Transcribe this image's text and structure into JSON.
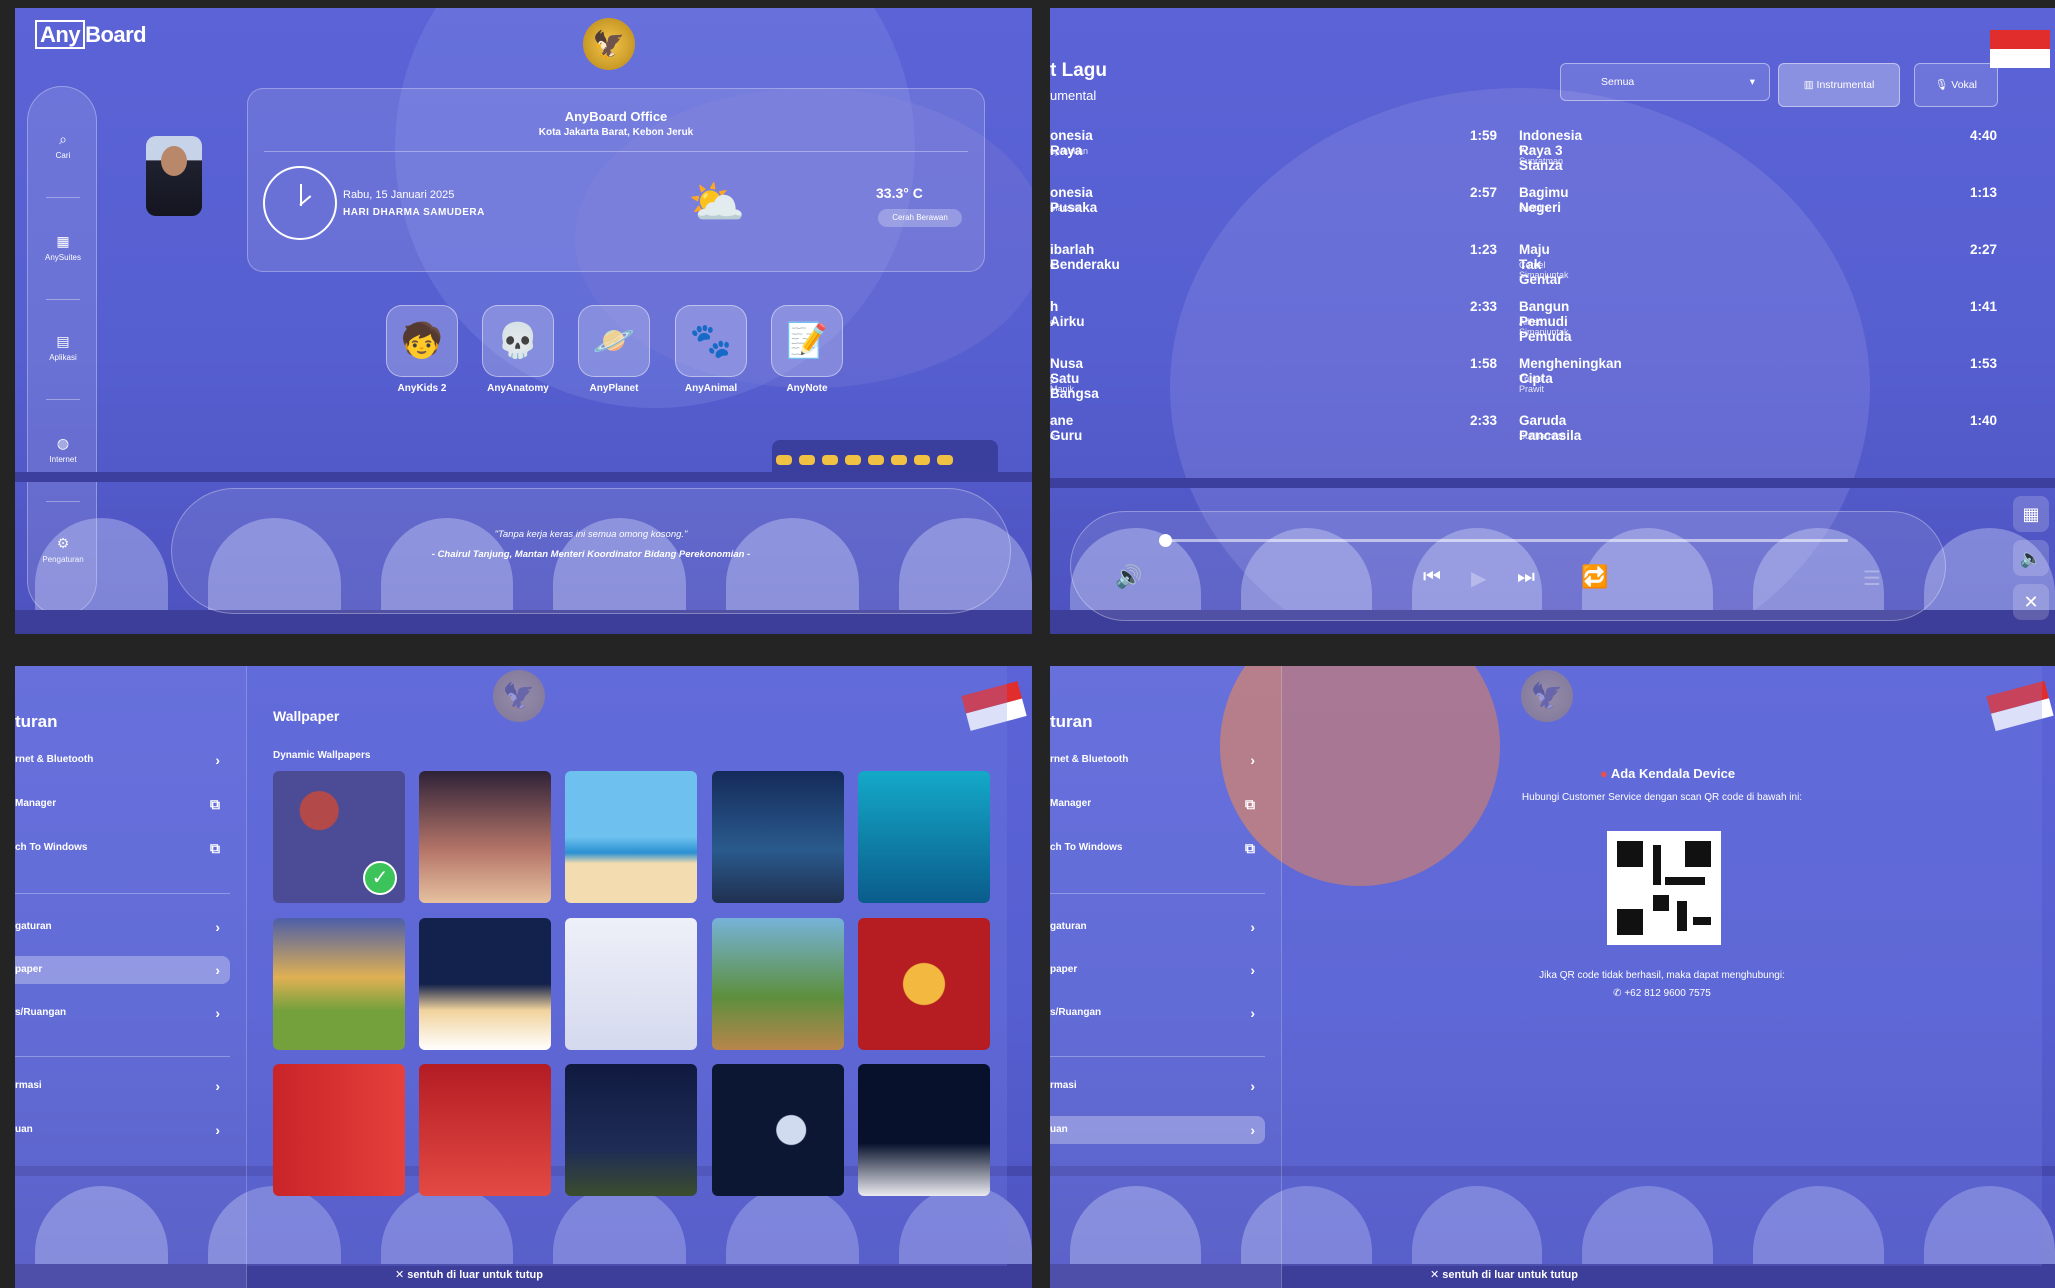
{
  "home": {
    "logo": "AnyBoard",
    "office_name": "AnyBoard Office",
    "office_location": "Kota Jakarta Barat, Kebon Jeruk",
    "date": "Rabu, 15 Januari 2025",
    "day_event": "HARI DHARMA SAMUDERA",
    "temperature": "33.3° C",
    "weather": "Cerah Berawan",
    "sidebar": [
      {
        "label": "Cari",
        "icon": "search-icon"
      },
      {
        "label": "AnySuites",
        "icon": "grid-icon"
      },
      {
        "label": "Aplikasi",
        "icon": "app-icon"
      },
      {
        "label": "Internet",
        "icon": "globe-icon"
      },
      {
        "label": "Pengaturan",
        "icon": "gear-icon"
      }
    ],
    "apps": [
      {
        "label": "AnyKids 2",
        "icon": "anykids-icon"
      },
      {
        "label": "AnyAnatomy",
        "icon": "skeleton-icon"
      },
      {
        "label": "AnyPlanet",
        "icon": "planet-icon"
      },
      {
        "label": "AnyAnimal",
        "icon": "paw-icon"
      },
      {
        "label": "AnyNote",
        "icon": "note-icon"
      }
    ],
    "quote": "\"Tanpa kerja keras ini semua omong kosong.\"",
    "quote_author": "- Chairul Tanjung, Mantan Menteri Koordinator Bidang Perekonomian -"
  },
  "music": {
    "title": "t Lagu",
    "subtitle": "umental",
    "filter_value": "Semua",
    "instrumental_label": "Instrumental",
    "vocal_label": "Vokal",
    "left_songs": [
      {
        "title": "onesia Raya",
        "artist": "upratman",
        "duration": "1:59"
      },
      {
        "title": "onesia Pusaka",
        "artist": "Marzuki",
        "duration": "2:57"
      },
      {
        "title": "ibarlah Benderaku",
        "artist": "d",
        "duration": "1:23"
      },
      {
        "title": "h Airku",
        "artist": "d",
        "duration": "2:33"
      },
      {
        "title": "Nusa Satu Bangsa",
        "artist": "y Manik",
        "duration": "1:58"
      },
      {
        "title": "ane Guru",
        "artist": "o",
        "duration": "2:33"
      }
    ],
    "right_songs": [
      {
        "title": "Indonesia Raya 3 Stanza",
        "artist": "W.R Supratman",
        "duration": "4:40"
      },
      {
        "title": "Bagimu Negeri",
        "artist": "Kusbini",
        "duration": "1:13"
      },
      {
        "title": "Maju Tak Gentar",
        "artist": "Cornel Simanjuntak",
        "duration": "2:27"
      },
      {
        "title": "Bangun Pemudi Pemuda",
        "artist": "Alfred Simanjuntak",
        "duration": "1:41"
      },
      {
        "title": "Mengheningkan Cipta",
        "artist": "Truno Prawit",
        "duration": "1:53"
      },
      {
        "title": "Garuda Pancasila",
        "artist": "Sudharnoto",
        "duration": "1:40"
      }
    ],
    "progress": 0
  },
  "settings": {
    "title": "turan",
    "menu": [
      {
        "label": "rnet & Bluetooth",
        "icon": "chevron-right-icon"
      },
      {
        "label": "Manager",
        "icon": "external-link-icon"
      },
      {
        "label": "ch To Windows",
        "icon": "external-link-icon"
      },
      {
        "label": "gaturan",
        "icon": "chevron-right-icon"
      },
      {
        "label": "paper",
        "icon": "chevron-right-icon"
      },
      {
        "label": "s/Ruangan",
        "icon": "chevron-right-icon"
      },
      {
        "label": "rmasi",
        "icon": "chevron-right-icon"
      },
      {
        "label": "uan",
        "icon": "chevron-right-icon"
      }
    ],
    "close_hint": "sentuh di luar untuk tutup"
  },
  "wallpaper": {
    "heading": "Wallpaper",
    "section": "Dynamic Wallpapers",
    "selected_index": 0
  },
  "help": {
    "heading": "Ada Kendala Device",
    "instruction": "Hubungi Customer Service dengan scan QR code di bawah ini:",
    "fallback": "Jika QR code tidak berhasil, maka dapat menghubungi:",
    "phone": "+62 812 9600 7575"
  },
  "colors": {
    "accent": "#5b63d6",
    "selected": "#3cc35a",
    "flag_red": "#e22d2d"
  }
}
